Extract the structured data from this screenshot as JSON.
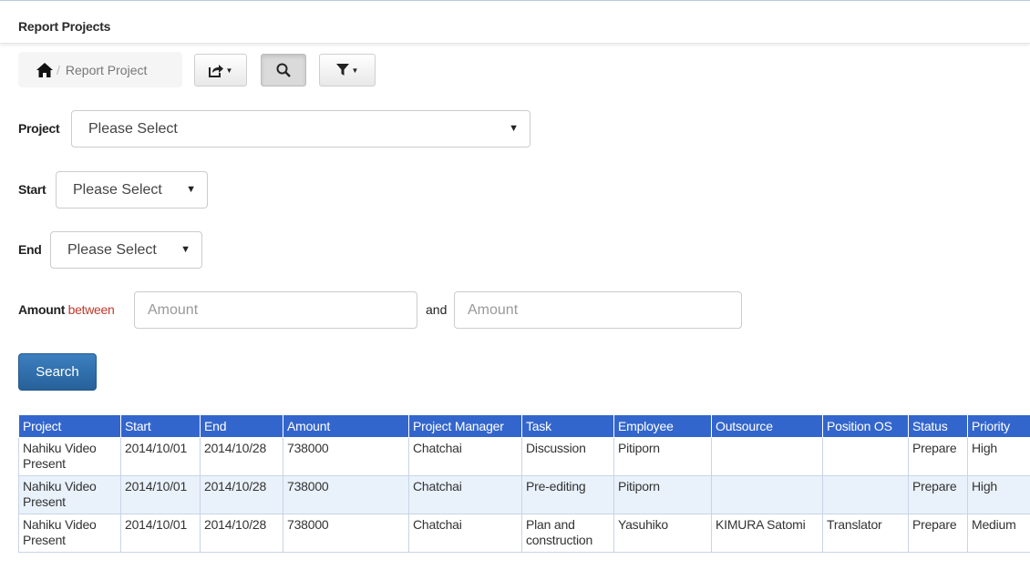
{
  "panel": {
    "title": "Report Projects"
  },
  "breadcrumb": {
    "home_icon": "home-icon",
    "separator": "/",
    "current": "Report Project"
  },
  "toolbar": {
    "export_icon": "share-export-icon",
    "search_icon": "magnifier-icon",
    "filter_icon": "funnel-filter-icon"
  },
  "form": {
    "project": {
      "label": "Project",
      "value": "Please Select"
    },
    "start": {
      "label": "Start",
      "value": "Please Select"
    },
    "end": {
      "label": "End",
      "value": "Please Select"
    },
    "amount": {
      "label": "Amount",
      "between": "between",
      "and": "and",
      "min_placeholder": "Amount",
      "max_placeholder": "Amount"
    },
    "search_label": "Search"
  },
  "colors": {
    "primary": "#2e6da4",
    "header": "#3366cc",
    "alt_row": "#e9f1fb",
    "accent_red": "#c0392b"
  },
  "table": {
    "columns": [
      "Project",
      "Start",
      "End",
      "Amount",
      "Project Manager",
      "Task",
      "Employee",
      "Outsource",
      "Position OS",
      "Status",
      "Priority"
    ],
    "rows": [
      [
        "Nahiku Video Present",
        "2014/10/01",
        "2014/10/28",
        "738000",
        "Chatchai",
        "Discussion",
        "Pitiporn",
        "",
        "",
        "Prepare",
        "High"
      ],
      [
        "Nahiku Video Present",
        "2014/10/01",
        "2014/10/28",
        "738000",
        "Chatchai",
        "Pre-editing",
        "Pitiporn",
        "",
        "",
        "Prepare",
        "High"
      ],
      [
        "Nahiku Video Present",
        "2014/10/01",
        "2014/10/28",
        "738000",
        "Chatchai",
        "Plan and construction",
        "Yasuhiko",
        "KIMURA Satomi",
        "Translator",
        "Prepare",
        "Medium"
      ]
    ]
  }
}
